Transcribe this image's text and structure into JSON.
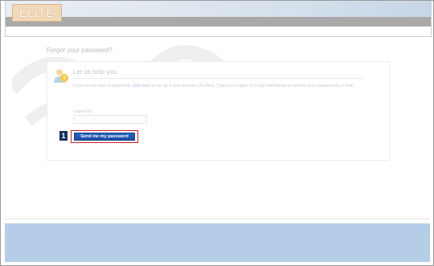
{
  "header": {
    "logo_text": "ELITE"
  },
  "page": {
    "title": "Forgot your password?"
  },
  "help": {
    "heading": "Let us help you",
    "text_before_link": "If you do not have a password, ",
    "link_text": "click here",
    "text_after_link": " to set up a new account (it's free). Type your Logon ID in the field below to receive your password by e-mail."
  },
  "form": {
    "logon_label": "Logon ID:",
    "logon_value": ""
  },
  "step": {
    "number": "1",
    "button_label": "Send me my password",
    "highlight_color": "#cc1f24"
  },
  "colors": {
    "footer": "#b5cde6",
    "button": "#1d4d9f"
  },
  "icons": {
    "help": "user-help-icon"
  }
}
